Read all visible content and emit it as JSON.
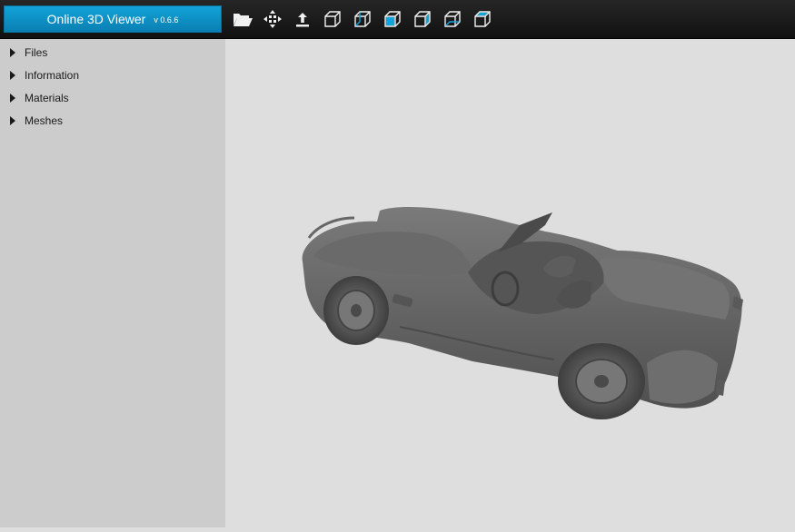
{
  "header": {
    "app_name": "Online 3D Viewer",
    "version": "v 0.6.6",
    "accent_color": "#0e94cb"
  },
  "toolbar": {
    "buttons": [
      {
        "icon": "folder-open-icon"
      },
      {
        "icon": "fit-to-window-icon"
      },
      {
        "icon": "set-up-vector-icon"
      },
      {
        "icon": "view-front-cube-icon"
      },
      {
        "icon": "view-back-cube-icon"
      },
      {
        "icon": "view-left-cube-icon"
      },
      {
        "icon": "view-right-cube-icon"
      },
      {
        "icon": "view-top-cube-icon"
      },
      {
        "icon": "view-bottom-cube-icon"
      }
    ]
  },
  "sidebar": {
    "items": [
      {
        "label": "Files"
      },
      {
        "label": "Information"
      },
      {
        "label": "Materials"
      },
      {
        "label": "Meshes"
      }
    ]
  },
  "viewport": {
    "model": "car-model",
    "background": "#dedede",
    "model_color": "#6b6b6b"
  }
}
